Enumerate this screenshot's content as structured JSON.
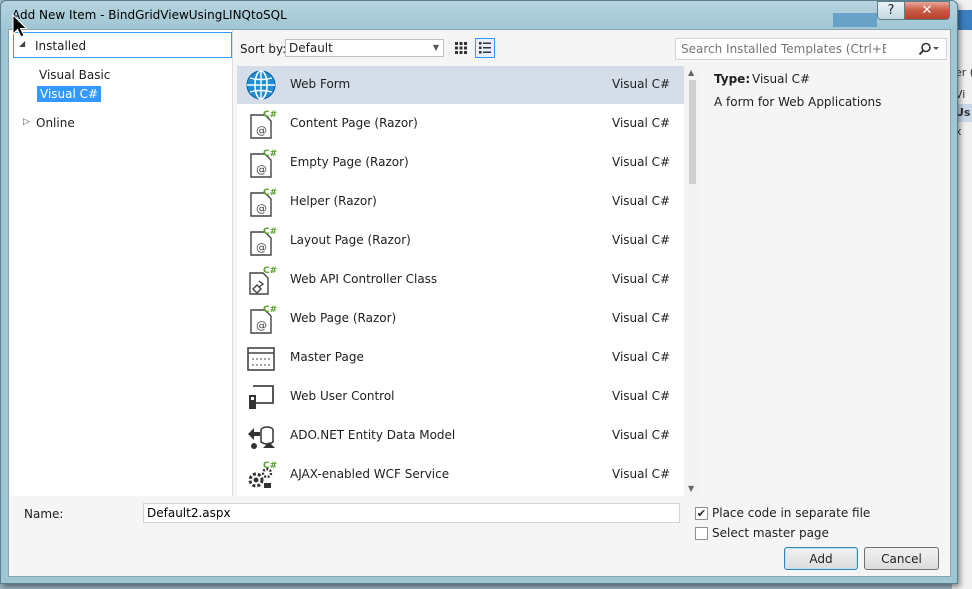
{
  "window": {
    "title": "Add New Item - BindGridViewUsingLINQtoSQL",
    "help_glyph": "?",
    "close_glyph": "✕"
  },
  "tree": {
    "installed": "Installed",
    "items": [
      "Visual Basic",
      "Visual C#"
    ],
    "online": "Online"
  },
  "sort": {
    "label": "Sort by:",
    "value": "Default"
  },
  "search": {
    "placeholder": "Search Installed Templates (Ctrl+E)"
  },
  "templates": [
    {
      "name": "Web Form",
      "lang": "Visual C#",
      "icon": "globe-icon",
      "selected": true
    },
    {
      "name": "Content Page (Razor)",
      "lang": "Visual C#",
      "icon": "razor-page-icon"
    },
    {
      "name": "Empty Page (Razor)",
      "lang": "Visual C#",
      "icon": "razor-page-icon"
    },
    {
      "name": "Helper (Razor)",
      "lang": "Visual C#",
      "icon": "razor-page-icon"
    },
    {
      "name": "Layout Page (Razor)",
      "lang": "Visual C#",
      "icon": "razor-page-icon"
    },
    {
      "name": "Web API Controller Class",
      "lang": "Visual C#",
      "icon": "controller-icon"
    },
    {
      "name": "Web Page (Razor)",
      "lang": "Visual C#",
      "icon": "razor-page-icon"
    },
    {
      "name": "Master Page",
      "lang": "Visual C#",
      "icon": "master-page-icon"
    },
    {
      "name": "Web User Control",
      "lang": "Visual C#",
      "icon": "user-control-icon"
    },
    {
      "name": "ADO.NET Entity Data Model",
      "lang": "Visual C#",
      "icon": "entity-model-icon"
    },
    {
      "name": "AJAX-enabled WCF Service",
      "lang": "Visual C#",
      "icon": "wcf-service-icon"
    }
  ],
  "details": {
    "type_label": "Type:",
    "type_value": "Visual C#",
    "description": "A form for Web Applications"
  },
  "bottom": {
    "name_label": "Name:",
    "name_value": "Default2.aspx",
    "option1": "Place code in separate file",
    "option1_checked": true,
    "option2": "Select master page",
    "option2_checked": false,
    "add": "Add",
    "cancel": "Cancel"
  },
  "background_ide": {
    "fragments": [
      "er (",
      "Vi",
      "Us",
      "x"
    ]
  },
  "colors": {
    "selection": "#3399ff",
    "selected_row": "#d4dde8",
    "csharp_badge": "#5aa02c"
  }
}
